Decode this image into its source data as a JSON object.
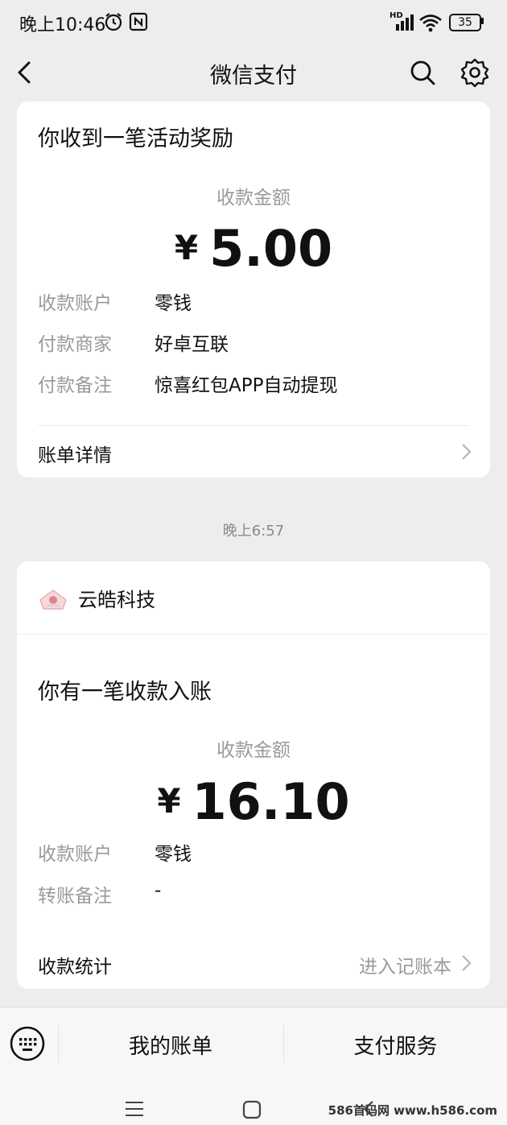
{
  "status_bar": {
    "time": "晚上10:46",
    "network": "HD",
    "battery": "35"
  },
  "nav": {
    "title": "微信支付",
    "icons": [
      "back-icon",
      "search-icon",
      "settings-icon"
    ]
  },
  "card1": {
    "title": "你收到一笔活动奖励",
    "amount_label": "收款金额",
    "currency": "¥",
    "amount": "5.00",
    "rows": [
      {
        "key": "收款账户",
        "value": "零钱"
      },
      {
        "key": "付款商家",
        "value": "好卓互联"
      },
      {
        "key": "付款备注",
        "value": "惊喜红包APP自动提现"
      }
    ],
    "detail_link": "账单详情"
  },
  "time_separator": "晚上6:57",
  "card2": {
    "merchant": "云皓科技",
    "title": "你有一笔收款入账",
    "amount_label": "收款金额",
    "currency": "¥",
    "amount": "16.10",
    "rows": [
      {
        "key": "收款账户",
        "value": "零钱"
      },
      {
        "key": "转账备注",
        "value": "-"
      }
    ],
    "stats_label": "收款统计",
    "stats_link": "进入记账本"
  },
  "bottom_bar": {
    "left": "我的账单",
    "right": "支付服务"
  },
  "watermark": "586首码网 www.h586.com",
  "colors": {
    "background": "#ededed",
    "card": "#ffffff",
    "muted_text": "#9a9a9a"
  }
}
